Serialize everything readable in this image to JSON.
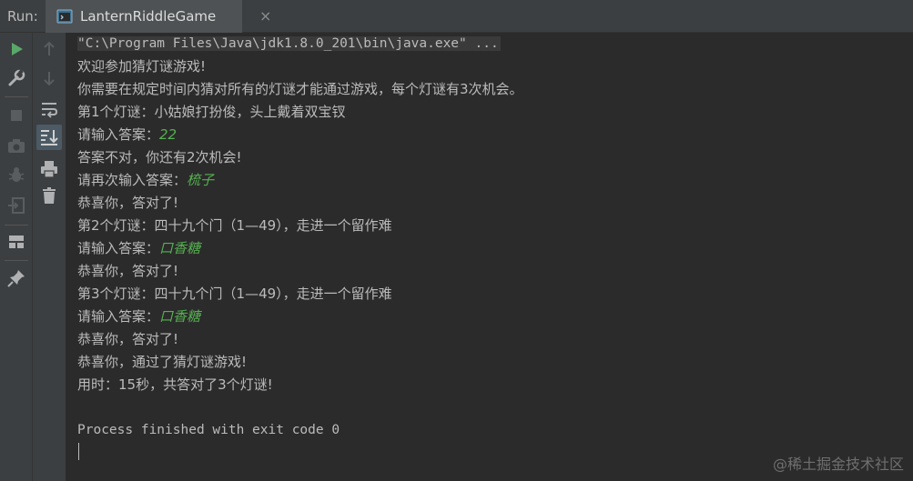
{
  "topbar": {
    "run_label": "Run:",
    "tab_title": "LanternRiddleGame",
    "tab_close": "×"
  },
  "console": {
    "lines": [
      {
        "text": "\"C:\\Program Files\\Java\\jdk1.8.0_201\\bin\\java.exe\" ..."
      },
      {
        "text": "欢迎参加猜灯谜游戏!"
      },
      {
        "text": "你需要在规定时间内猜对所有的灯谜才能通过游戏，每个灯谜有3次机会。"
      },
      {
        "text": "第1个灯谜：小姑娘打扮俊，头上戴着双宝钗"
      },
      {
        "prompt": "请输入答案：",
        "input": "22"
      },
      {
        "text": "答案不对，你还有2次机会!"
      },
      {
        "prompt": "请再次输入答案：",
        "input": "梳子"
      },
      {
        "text": "恭喜你，答对了!"
      },
      {
        "text": "第2个灯谜：四十九个门（1—49），走进一个留作难"
      },
      {
        "prompt": "请输入答案：",
        "input": "口香糖"
      },
      {
        "text": "恭喜你，答对了!"
      },
      {
        "text": "第3个灯谜：四十九个门（1—49），走进一个留作难"
      },
      {
        "prompt": "请输入答案：",
        "input": "口香糖"
      },
      {
        "text": "恭喜你，答对了!"
      },
      {
        "text": "恭喜你，通过了猜灯谜游戏!"
      },
      {
        "text": "用时：15秒，共答对了3个灯谜!"
      },
      {
        "text": ""
      },
      {
        "text": "Process finished with exit code 0"
      }
    ]
  },
  "watermark": "@稀土掘金技术社区",
  "colors": {
    "background": "#2b2b2b",
    "panel": "#3c3f41",
    "text": "#bbbbbb",
    "user_input": "#56b051",
    "run_green": "#59a869"
  },
  "icons": {
    "left_toolbar": [
      "run-icon",
      "wrench-icon",
      "stop-icon",
      "camera-icon",
      "debug-icon",
      "exit-icon",
      "layout-icon",
      "pin-icon"
    ],
    "right_toolbar": [
      "up-arrow-icon",
      "down-arrow-icon",
      "soft-wrap-icon",
      "scroll-to-end-icon",
      "print-icon",
      "trash-icon"
    ]
  }
}
